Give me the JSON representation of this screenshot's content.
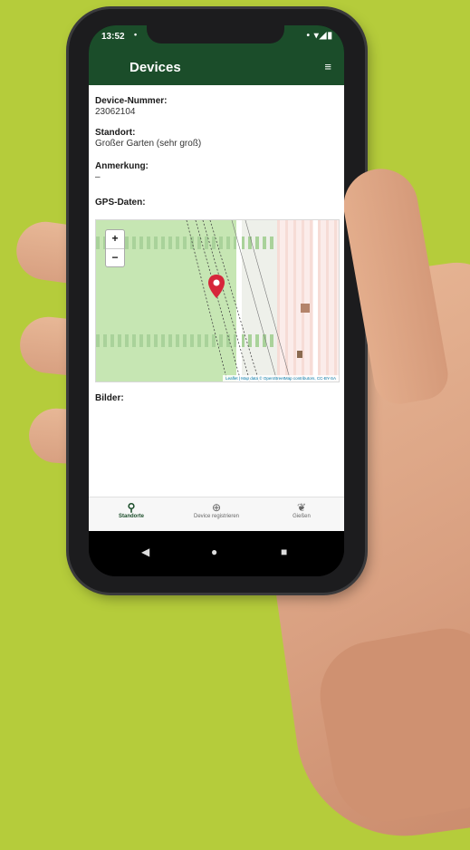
{
  "status_bar": {
    "time": "13:52",
    "dot": "•",
    "icons": "• ▾◢▮"
  },
  "app_bar": {
    "title": "Devices",
    "menu_icon": "menu-icon"
  },
  "device": {
    "number_label": "Device-Nummer:",
    "number_value": "23062104",
    "location_label": "Standort:",
    "location_value": "Großer Garten (sehr groß)",
    "note_label": "Anmerkung:",
    "note_value": "–",
    "gps_label": "GPS-Daten:",
    "images_label": "Bilder:"
  },
  "map": {
    "zoom_in": "+",
    "zoom_out": "−",
    "attribution": "Leaflet | Map data © OpenStreetMap contributors, CC-BY-SA"
  },
  "bottom_nav": [
    {
      "label": "Standorte",
      "icon": "location-pin-icon",
      "glyph": "⚲",
      "active": true
    },
    {
      "label": "Device registrieren",
      "icon": "add-circle-icon",
      "glyph": "⊕",
      "active": false
    },
    {
      "label": "Gießen",
      "icon": "leaf-icon",
      "glyph": "❦",
      "active": false
    }
  ],
  "system_nav": {
    "back": "◀",
    "home": "●",
    "recents": "■"
  },
  "colors": {
    "background": "#b5cc3b",
    "primary": "#1b4d2a",
    "marker": "#d6263a"
  }
}
